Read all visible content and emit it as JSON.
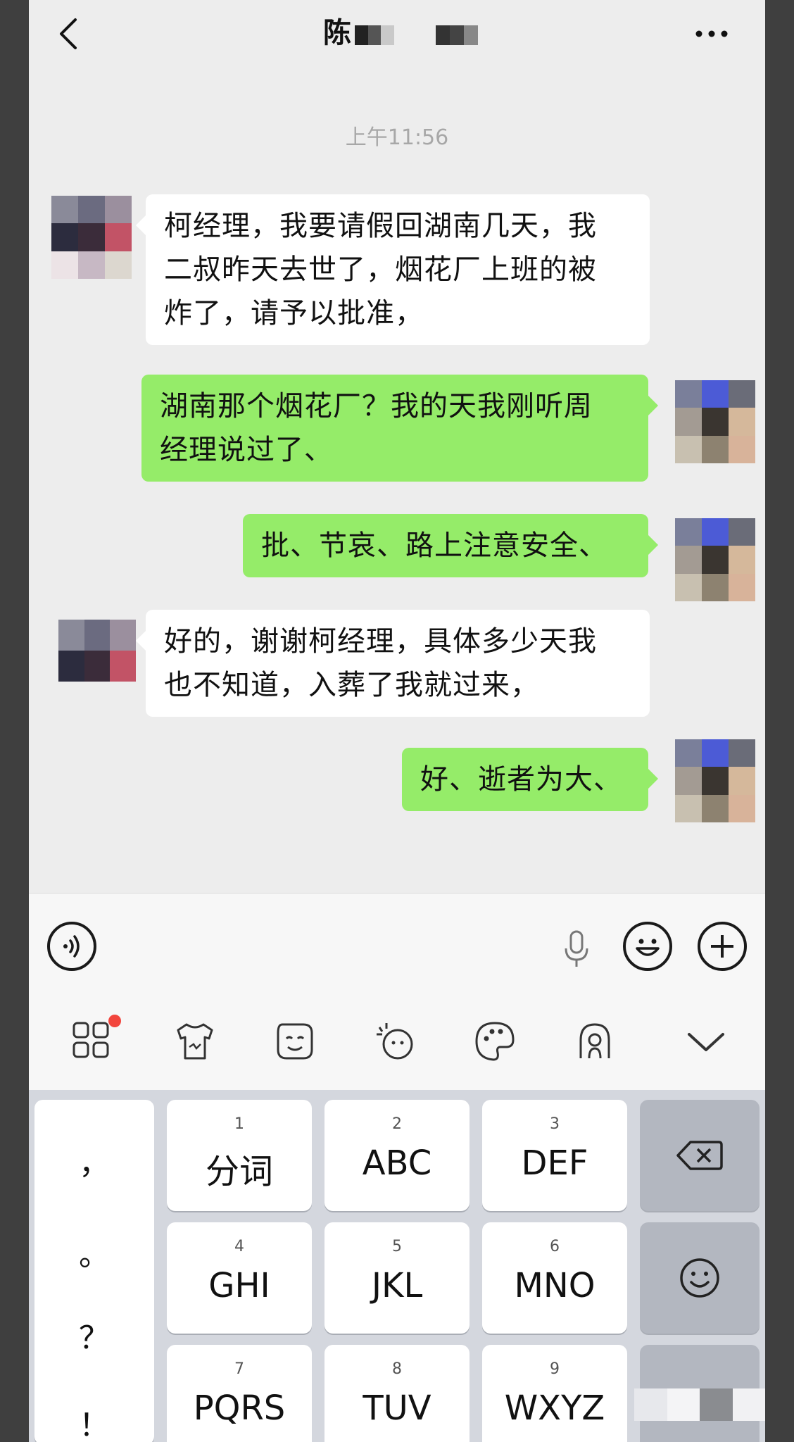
{
  "header": {
    "contact_name": "陈",
    "timestamp": "上午11:56"
  },
  "messages": [
    {
      "direction": "in",
      "lines": [
        "柯经理，我要请假回湖南几天，我",
        "二叔昨天去世了，烟花厂上班的被",
        "炸了，请予以批准，"
      ]
    },
    {
      "direction": "out",
      "lines": [
        "湖南那个烟花厂？我的天我刚听周",
        "经理说过了、"
      ]
    },
    {
      "direction": "out",
      "lines": [
        "批、节哀、路上注意安全、"
      ]
    },
    {
      "direction": "in",
      "lines": [
        "好的，谢谢柯经理，具体多少天我",
        "也不知道，入葬了我就过来，"
      ]
    },
    {
      "direction": "out",
      "lines": [
        "好、逝者为大、"
      ]
    }
  ],
  "input_bar": {
    "icons": [
      "voice-icon",
      "microphone-icon",
      "emoji-icon",
      "add-icon"
    ]
  },
  "keyboard_toolbar": {
    "icons": [
      "apps-grid-icon",
      "tshirt-skin-icon",
      "sticker-icon",
      "emoji-sticker-icon",
      "palette-icon",
      "swipe-gesture-icon",
      "collapse-keyboard-icon"
    ],
    "badge_color": "#f2453d"
  },
  "keyboard": {
    "punctuation": [
      "，",
      "。",
      "？",
      "！"
    ],
    "keys": [
      {
        "num": "1",
        "label": "分词"
      },
      {
        "num": "2",
        "label": "ABC"
      },
      {
        "num": "3",
        "label": "DEF"
      },
      {
        "num": "4",
        "label": "GHI"
      },
      {
        "num": "5",
        "label": "JKL"
      },
      {
        "num": "6",
        "label": "MNO"
      },
      {
        "num": "7",
        "label": "PQRS"
      },
      {
        "num": "8",
        "label": "TUV"
      },
      {
        "num": "9",
        "label": "WXYZ"
      }
    ],
    "side_icons": [
      "backspace-icon",
      "smiley-key-icon"
    ]
  },
  "colors": {
    "outgoing_bubble": "#95ec69",
    "incoming_bubble": "#ffffff",
    "chat_background": "#ededed",
    "keyboard_background": "#d4d7de"
  }
}
